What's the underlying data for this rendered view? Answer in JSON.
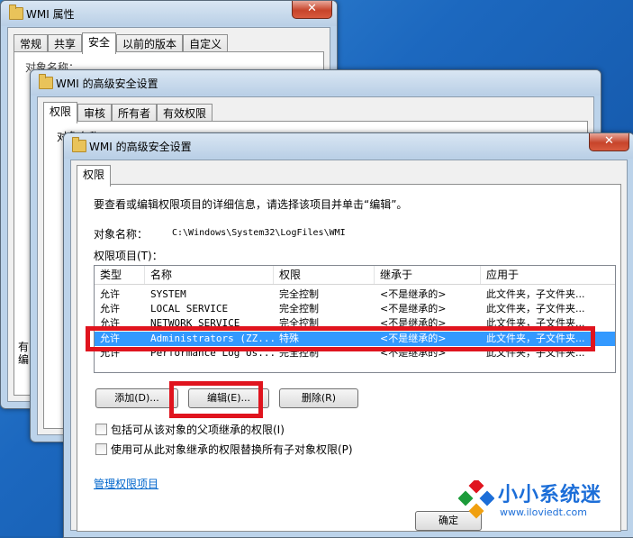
{
  "back_window": {
    "title": "WMI 属性",
    "close": "✕",
    "tabs": [
      "常规",
      "共享",
      "安全",
      "以前的版本",
      "自定义"
    ],
    "active_tab": 2,
    "label": "对象名称："
  },
  "mid_window": {
    "title": "WMI 的高级安全设置",
    "close": "✕",
    "tabs": [
      "权限",
      "审核",
      "所有者",
      "有效权限"
    ],
    "label": "对象名称："
  },
  "front_window": {
    "title": "WMI 的高级安全设置",
    "close": "✕",
    "tab": "权限",
    "instruction": "要查看或编辑权限项目的详细信息，请选择该项目并单击“编辑”。",
    "object_label": "对象名称：",
    "object_path": "C:\\Windows\\System32\\LogFiles\\WMI",
    "entries_label": "权限项目(T)：",
    "columns": [
      "类型",
      "名称",
      "权限",
      "继承于",
      "应用于"
    ],
    "rows": [
      [
        "允许",
        "SYSTEM",
        "完全控制",
        "<不是继承的>",
        "此文件夹，子文件夹..."
      ],
      [
        "允许",
        "LOCAL SERVICE",
        "完全控制",
        "<不是继承的>",
        "此文件夹，子文件夹..."
      ],
      [
        "允许",
        "NETWORK SERVICE",
        "完全控制",
        "<不是继承的>",
        "此文件夹，子文件夹..."
      ],
      [
        "允许",
        "Administrators (ZZ...",
        "特殊",
        "<不是继承的>",
        "此文件夹，子文件夹..."
      ],
      [
        "允许",
        "Performance Log Us...",
        "完全控制",
        "<不是继承的>",
        "此文件夹，子文件夹..."
      ]
    ],
    "selected_row": 3,
    "add_button": "添加(D)...",
    "edit_button": "编辑(E)...",
    "remove_button": "删除(R)",
    "checkbox_inherit": "包括可从该对象的父项继承的权限(I)",
    "checkbox_replace": "使用可从此对象继承的权限替换所有子对象权限(P)",
    "manage_link": "管理权限项目",
    "ok_button": "确定"
  },
  "background_fragments": {
    "left_char_1": "有",
    "left_char_2": "编"
  },
  "watermark": {
    "name": "小小系统迷",
    "url": "www.iloviedt.com"
  },
  "colors": {
    "highlight_red": "#e0141e",
    "selection_blue": "#3399ff",
    "link_blue": "#0066cc"
  }
}
